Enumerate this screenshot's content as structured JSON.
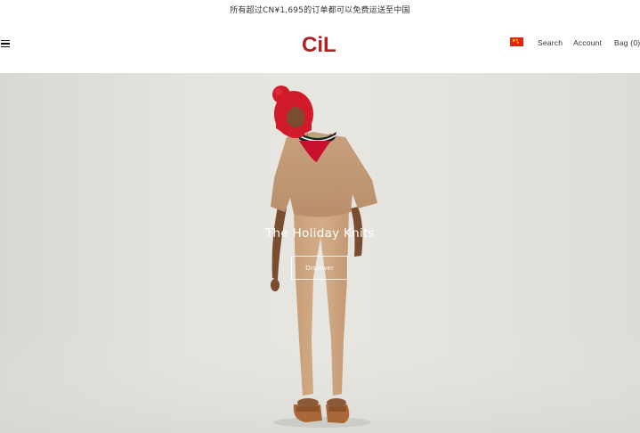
{
  "announcement": {
    "text": "所有超过CN¥1,695的订单都可以免费运送至中国"
  },
  "header": {
    "logo_text": "CiL",
    "nav": {
      "search_label": "Search",
      "account_label": "Account",
      "bag_label": "Bag (0)"
    },
    "flag_icon": "china-flag-icon",
    "menu_icon": "hamburger-menu-icon"
  },
  "hero": {
    "title": "The Holiday Knits",
    "cta_label": "Discover"
  },
  "colors": {
    "brand": "#b22222",
    "hero_background": "#e4e3de",
    "hero_text": "#ffffff"
  }
}
